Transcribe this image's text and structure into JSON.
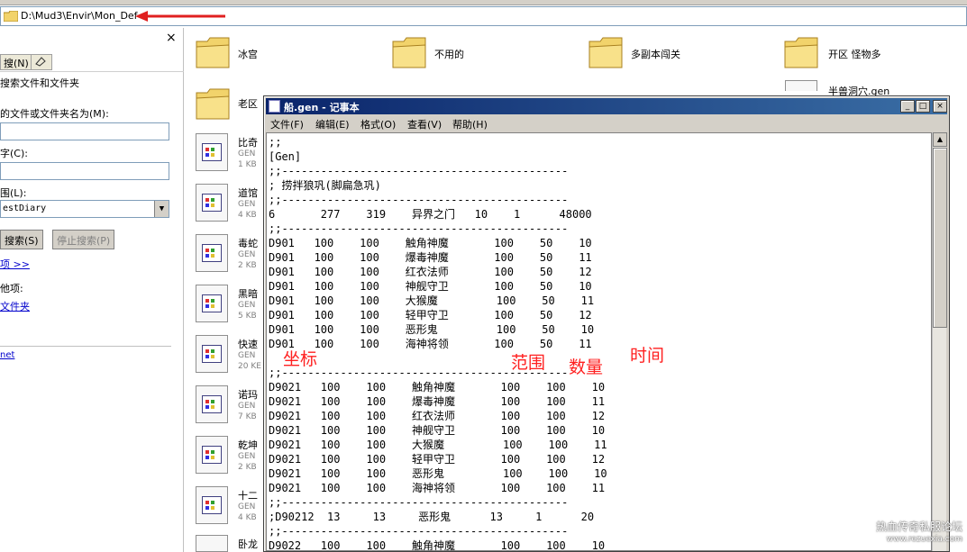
{
  "address_bar": {
    "path": "D:\\Mud3\\Envir\\Mon_Def"
  },
  "search_pane": {
    "close": "×",
    "tool_btn_1": "(N)",
    "tool_btn_1_prefix": "搜",
    "header": "搜索文件和文件夹",
    "name_label": "的文件或文件夹名为(M):",
    "text_label": "字(C):",
    "scope_label": "围(L):",
    "scope_value": "estDiary",
    "search_btn": "搜索(S)",
    "stop_btn": "停止搜索(P)",
    "more_link": "项 >>",
    "other_label": "他项:",
    "files_link": "文件夹",
    "net_link": "net"
  },
  "folders": [
    {
      "name": "冰宫"
    },
    {
      "name": "不用的"
    },
    {
      "name": "多副本闯关"
    },
    {
      "name": "开区 怪物多"
    },
    {
      "name": "老区"
    }
  ],
  "file_partial": "半兽洞穴.gen",
  "gen_files": [
    {
      "name": "比奇",
      "type": "GEN",
      "size": "1 KB"
    },
    {
      "name": "道馆",
      "type": "GEN",
      "size": "4 KB"
    },
    {
      "name": "毒蛇",
      "type": "GEN",
      "size": "2 KB"
    },
    {
      "name": "黑暗",
      "type": "GEN",
      "size": "5 KB"
    },
    {
      "name": "快速",
      "type": "GEN",
      "size": "20 KE"
    },
    {
      "name": "诺玛",
      "type": "GEN",
      "size": "7 KB"
    },
    {
      "name": "乾坤",
      "type": "GEN",
      "size": "2 KB"
    },
    {
      "name": "十二",
      "type": "GEN",
      "size": "4 KB"
    },
    {
      "name": "卧龙",
      "type": "",
      "size": ""
    }
  ],
  "notepad": {
    "title": "船.gen - 记事本",
    "menu": [
      "文件(F)",
      "编辑(E)",
      "格式(O)",
      "查看(V)",
      "帮助(H)"
    ],
    "min": "_",
    "max": "□",
    "close": "×",
    "content": ";;\n[Gen]\n;;--------------------------------------------\n; 捞拌狼巩(脚扁急巩)\n;;--------------------------------------------\n6       277    319    异界之门   10    1      48000\n;;--------------------------------------------\nD901   100    100    触角神魔       100    50    10\nD901   100    100    爆毒神魔       100    50    11\nD901   100    100    红衣法师       100    50    12\nD901   100    100    神舰守卫       100    50    10\nD901   100    100    大猴魔         100    50    11\nD901   100    100    轻甲守卫       100    50    12\nD901   100    100    恶形鬼         100    50    10\nD901   100    100    海神将领       100    50    11\n\n;;--------------------------------------------\nD9021   100    100    触角神魔       100    100    10\nD9021   100    100    爆毒神魔       100    100    11\nD9021   100    100    红衣法师       100    100    12\nD9021   100    100    神舰守卫       100    100    10\nD9021   100    100    大猴魔         100    100    11\nD9021   100    100    轻甲守卫       100    100    12\nD9021   100    100    恶形鬼         100    100    10\nD9021   100    100    海神将领       100    100    11\n;;--------------------------------------------\n;D90212  13     13     恶形鬼      13     1      20\n;;--------------------------------------------\nD9022   100    100    触角神魔       100    100    10"
  },
  "annotations": {
    "coord": "坐标",
    "range": "范围",
    "count": "数量",
    "time": "时间"
  },
  "watermark": {
    "line1": "热血传奇私服论坛",
    "line2": "www.rezuexia.com"
  },
  "colors": {
    "annotation": "#ff2020",
    "title_bar": "#0a246a",
    "arrow": "#e02020"
  }
}
